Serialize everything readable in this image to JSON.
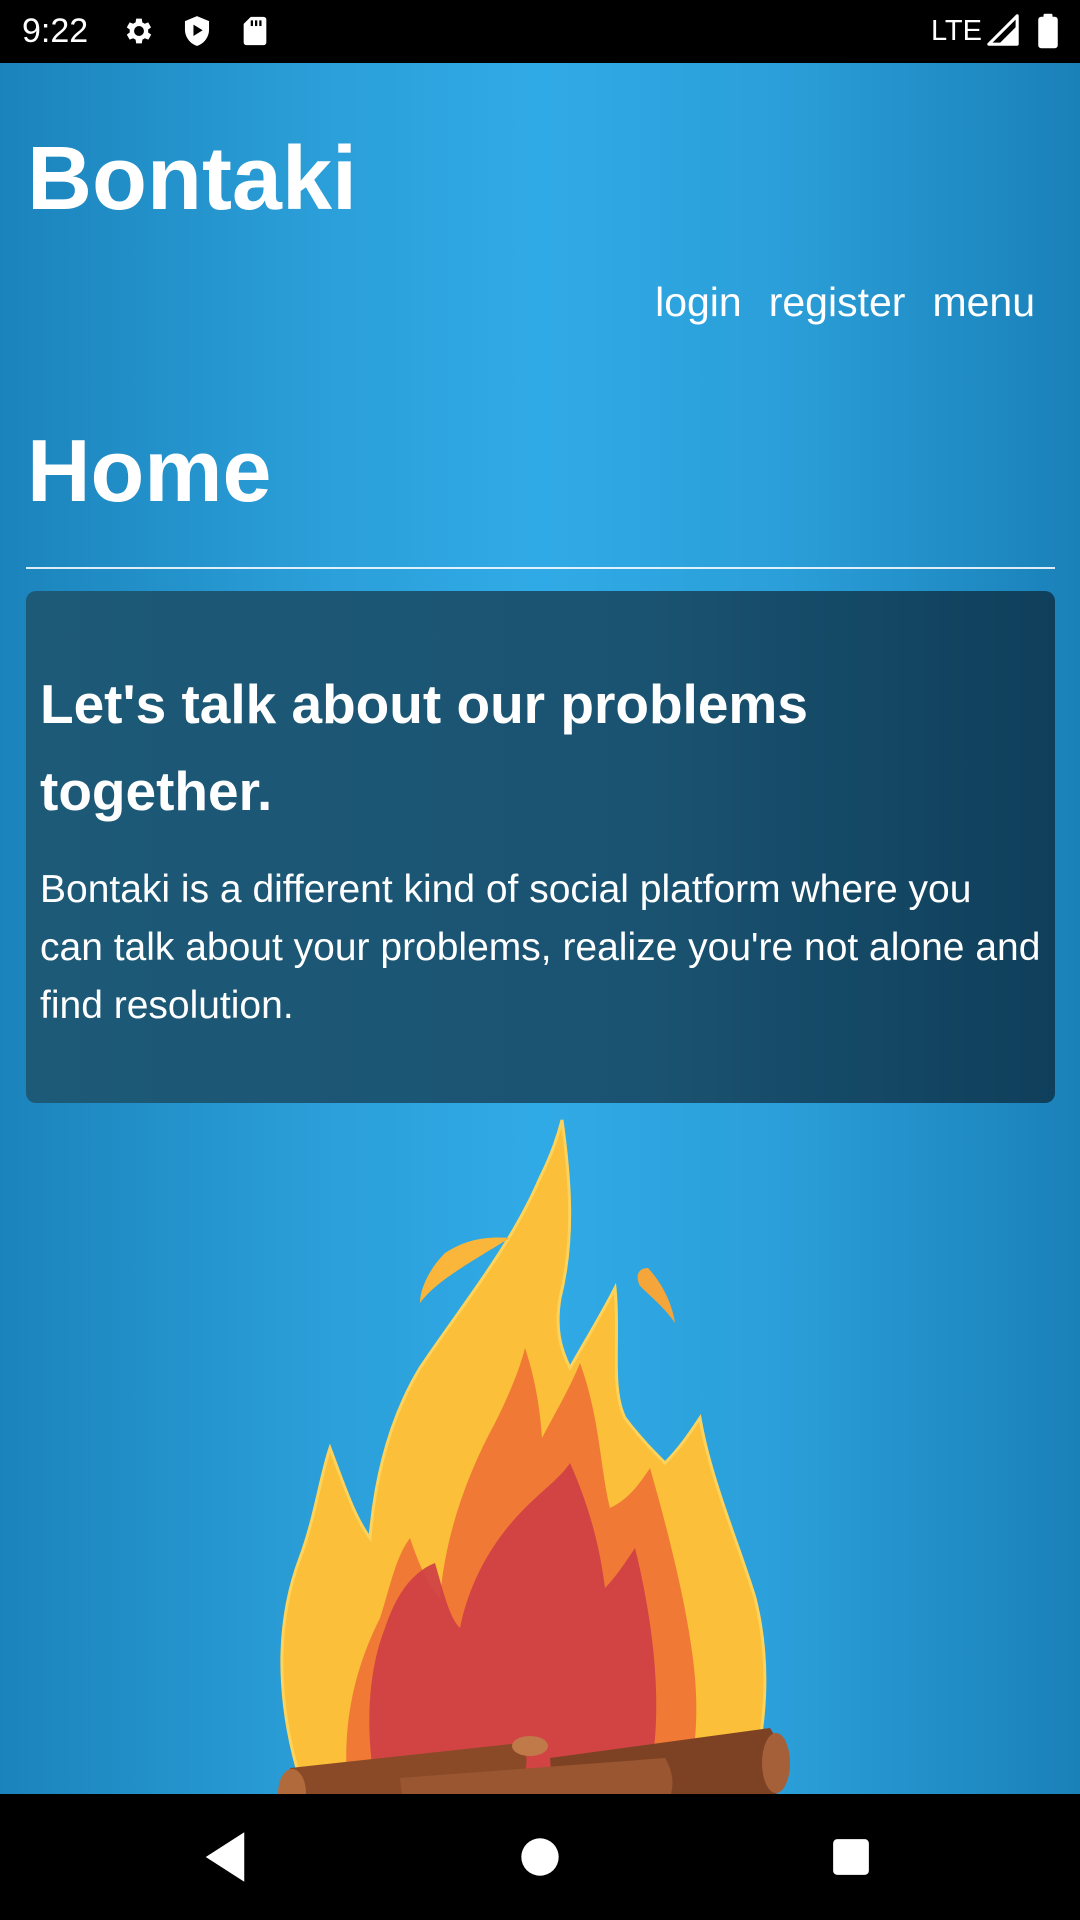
{
  "status_bar": {
    "time": "9:22",
    "network": "LTE",
    "icons": [
      "gear-icon",
      "shield-play-icon",
      "sd-card-icon",
      "signal-icon",
      "battery-icon"
    ]
  },
  "header": {
    "brand": "Bontaki",
    "nav": {
      "login": "login",
      "register": "register",
      "menu": "menu"
    }
  },
  "main": {
    "page_title": "Home",
    "hero": {
      "heading": "Let's talk about our problems together.",
      "text": "Bontaki is a different kind of social platform where you can talk about your problems, realize you're not alone and find resolution."
    },
    "illustration": "campfire"
  },
  "nav_bar": {
    "buttons": [
      "back-icon",
      "home-icon",
      "recents-icon"
    ]
  },
  "colors": {
    "background": "#2b9fd9",
    "card": "#1a5371",
    "text": "#ffffff",
    "flame_outer": "#fbbf3a",
    "flame_mid": "#f07a35",
    "flame_inner": "#cf3f45",
    "logs": "#8a4a28"
  }
}
